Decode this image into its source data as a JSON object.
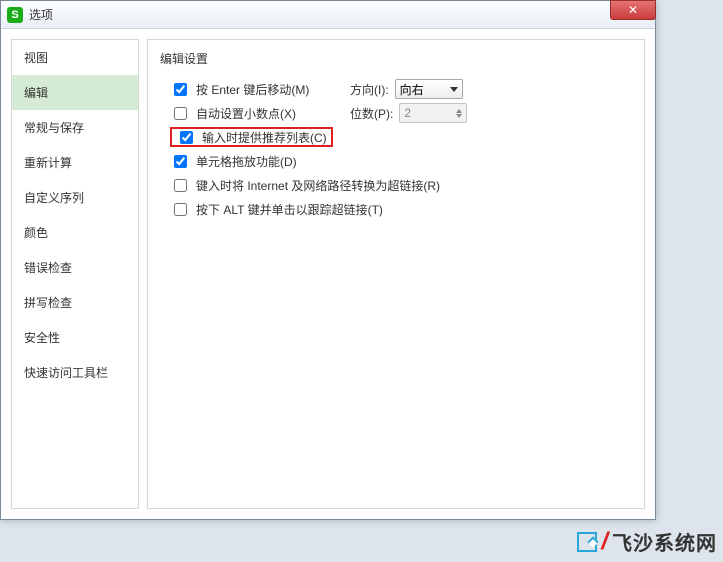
{
  "window": {
    "title": "选项",
    "app_icon_letter": "S",
    "close_glyph": "✕"
  },
  "sidebar": {
    "items": [
      {
        "label": "视图"
      },
      {
        "label": "编辑"
      },
      {
        "label": "常规与保存"
      },
      {
        "label": "重新计算"
      },
      {
        "label": "自定义序列"
      },
      {
        "label": "颜色"
      },
      {
        "label": "错误检查"
      },
      {
        "label": "拼写检查"
      },
      {
        "label": "安全性"
      },
      {
        "label": "快速访问工具栏"
      }
    ],
    "active_index": 1
  },
  "main": {
    "section_title": "编辑设置",
    "rows": {
      "enter_move": {
        "label": "按 Enter 键后移动(M)",
        "checked": true
      },
      "direction": {
        "label": "方向(I):",
        "value": "向右"
      },
      "auto_decimal": {
        "label": "自动设置小数点(X)",
        "checked": false
      },
      "places": {
        "label": "位数(P):",
        "value": "2"
      },
      "autocomplete": {
        "label": "输入时提供推荐列表(C)",
        "checked": true
      },
      "drag_fill": {
        "label": "单元格拖放功能(D)",
        "checked": true
      },
      "hyperlink": {
        "label": "键入时将 Internet 及网络路径转换为超链接(R)",
        "checked": false
      },
      "alt_click": {
        "label": "按下 ALT 键并单击以跟踪超链接(T)",
        "checked": false
      }
    }
  },
  "watermark": {
    "slash": "/",
    "text": "飞沙系统网"
  }
}
